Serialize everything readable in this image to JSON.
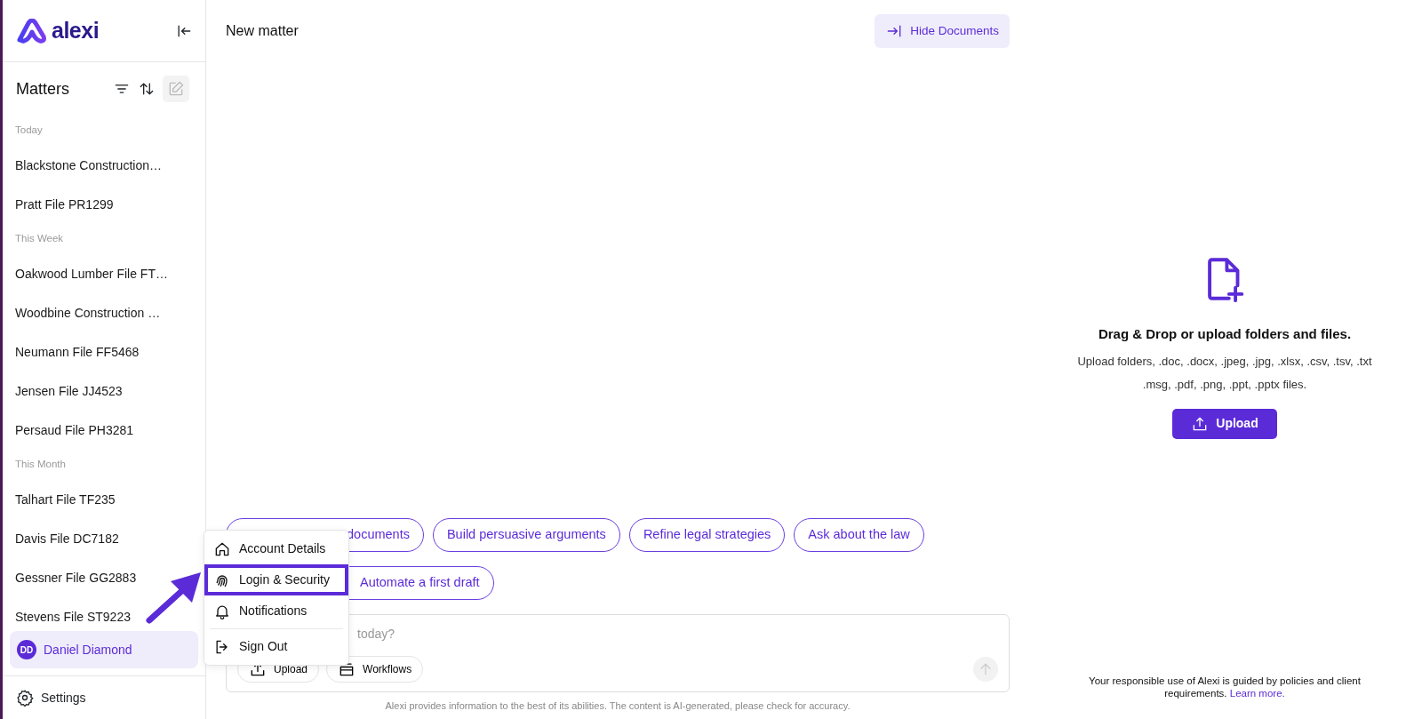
{
  "logo": {
    "text": "alexi"
  },
  "sidebar": {
    "title": "Matters",
    "groups": [
      {
        "label": "Today",
        "items": [
          {
            "name": "Blackstone Construction…",
            "selected": false
          },
          {
            "name": "Pratt File PR1299",
            "selected": false
          }
        ]
      },
      {
        "label": "This Week",
        "items": [
          {
            "name": "Oakwood Lumber File FT…",
            "selected": false
          },
          {
            "name": "Woodbine Construction …",
            "selected": false
          },
          {
            "name": "Neumann File FF5468",
            "selected": false
          },
          {
            "name": "Jensen File JJ4523",
            "selected": false
          },
          {
            "name": "Persaud File PH3281",
            "selected": false
          }
        ]
      },
      {
        "label": "This Month",
        "items": [
          {
            "name": "Talhart File TF235",
            "selected": false
          },
          {
            "name": "Davis File DC7182",
            "selected": false
          },
          {
            "name": "Gessner File GG2883",
            "selected": false
          },
          {
            "name": "Stevens File ST9223",
            "selected": false
          }
        ]
      }
    ],
    "user": {
      "initials": "DD",
      "name": "Daniel Diamond",
      "selected": true
    },
    "settings": "Settings"
  },
  "main": {
    "title": "New matter",
    "hide_button": "Hide Documents",
    "suggestions": [
      {
        "label": "documents",
        "covered": true
      },
      {
        "label": "Build persuasive arguments",
        "covered": false
      },
      {
        "label": "Refine legal strategies",
        "covered": false
      },
      {
        "label": "Ask about the law",
        "covered": false
      },
      {
        "label": "Automate a first draft",
        "covered": true
      }
    ],
    "composer": {
      "placeholder": "today?",
      "buttons": [
        {
          "label": "Upload",
          "kind": "upload"
        },
        {
          "label": "Workflows",
          "kind": "workflows"
        }
      ]
    },
    "disclaimer": "Alexi provides information to the best of its abilities. The content is AI-generated, please check for accuracy."
  },
  "user_menu": [
    {
      "label": "Account Details",
      "kind": "home",
      "highlighted": false
    },
    {
      "label": "Login & Security",
      "kind": "fingerprint",
      "highlighted": true
    },
    {
      "label": "Notifications",
      "kind": "bell",
      "highlighted": false
    },
    {
      "label": "Sign Out",
      "kind": "signout",
      "highlighted": false
    }
  ],
  "documents": {
    "heading": "Drag & Drop or upload folders and files.",
    "formats": [
      "Upload folders, .doc, .docx, .jpeg, .jpg, .xlsx, .csv, .tsv, .txt",
      ".msg, .pdf, .png, .ppt, .pptx files."
    ],
    "upload_button": "Upload",
    "footer_text": "Your responsible use of Alexi is guided by policies and client requirements.",
    "footer_link": "Learn more."
  }
}
